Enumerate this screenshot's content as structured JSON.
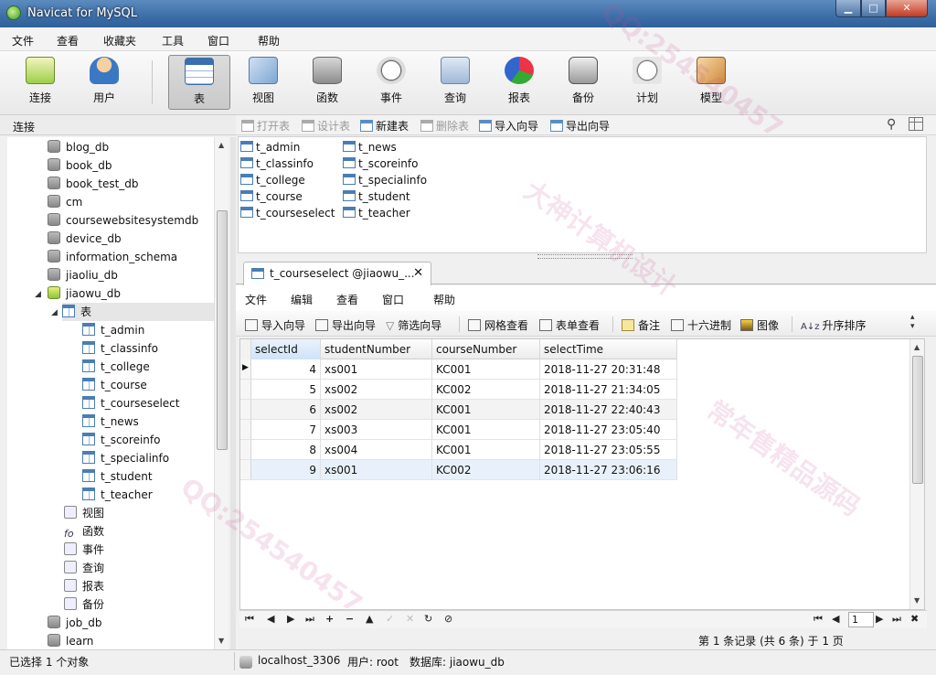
{
  "window": {
    "title": "Navicat for MySQL"
  },
  "menu": [
    "文件",
    "查看",
    "收藏夹",
    "工具",
    "窗口",
    "帮助"
  ],
  "toolbar": [
    {
      "label": "连接",
      "icon": "connection-icon"
    },
    {
      "label": "用户",
      "icon": "user-icon"
    },
    {
      "label": "表",
      "icon": "table-icon",
      "active": true
    },
    {
      "label": "视图",
      "icon": "view-icon"
    },
    {
      "label": "函数",
      "icon": "function-icon"
    },
    {
      "label": "事件",
      "icon": "event-icon"
    },
    {
      "label": "查询",
      "icon": "query-icon"
    },
    {
      "label": "报表",
      "icon": "report-icon"
    },
    {
      "label": "备份",
      "icon": "backup-icon"
    },
    {
      "label": "计划",
      "icon": "schedule-icon"
    },
    {
      "label": "模型",
      "icon": "model-icon"
    }
  ],
  "sidebar": {
    "header": "连接",
    "databases_top": [
      "blog_db",
      "book_db",
      "book_test_db",
      "cm",
      "coursewebsitesystemdb",
      "device_db",
      "information_schema",
      "jiaoliu_db"
    ],
    "open_db": "jiaowu_db",
    "tables_folder": "表",
    "tables": [
      "t_admin",
      "t_classinfo",
      "t_college",
      "t_course",
      "t_courseselect",
      "t_news",
      "t_scoreinfo",
      "t_specialinfo",
      "t_student",
      "t_teacher"
    ],
    "folders": [
      "视图",
      "函数",
      "事件",
      "查询",
      "报表",
      "备份"
    ],
    "databases_bottom": [
      "job_db",
      "learn"
    ]
  },
  "object_toolbar": {
    "open": "打开表",
    "design": "设计表",
    "new": "新建表",
    "delete": "删除表",
    "import": "导入向导",
    "export": "导出向导"
  },
  "objects": [
    "t_admin",
    "t_classinfo",
    "t_college",
    "t_course",
    "t_courseselect",
    "t_news",
    "t_scoreinfo",
    "t_specialinfo",
    "t_student",
    "t_teacher"
  ],
  "doc_tab": {
    "label": "t_courseselect @jiaowu_...",
    "close": "✕"
  },
  "doc_menu": [
    "文件",
    "编辑",
    "查看",
    "窗口",
    "帮助"
  ],
  "doc_toolbar": {
    "import": "导入向导",
    "export": "导出向导",
    "filter": "筛选向导",
    "grid": "网格查看",
    "form": "表单查看",
    "memo": "备注",
    "hex": "十六进制",
    "image": "图像",
    "sort": "升序排序"
  },
  "grid": {
    "columns": [
      "selectId",
      "studentNumber",
      "courseNumber",
      "selectTime"
    ],
    "rows": [
      [
        "4",
        "xs001",
        "KC001",
        "2018-11-27 20:31:48"
      ],
      [
        "5",
        "xs002",
        "KC002",
        "2018-11-27 21:34:05"
      ],
      [
        "6",
        "xs002",
        "KC001",
        "2018-11-27 22:40:43"
      ],
      [
        "7",
        "xs003",
        "KC001",
        "2018-11-27 23:05:40"
      ],
      [
        "8",
        "xs004",
        "KC001",
        "2018-11-27 23:05:55"
      ],
      [
        "9",
        "xs001",
        "KC002",
        "2018-11-27 23:06:16"
      ]
    ]
  },
  "nav": {
    "page": "1"
  },
  "record_info": "第 1 条记录 (共 6 条) 于 1 页",
  "status": {
    "selection": "已选择 1 个对象",
    "connection": "localhost_3306",
    "user": "用户: root",
    "database": "数据库: jiaowu_db"
  },
  "watermarks": [
    "大神计算机设计",
    "QQ:254540457",
    "常年售精品源码"
  ],
  "colors": {
    "titlebar": "#3d6ea8",
    "selection": "#e8f1fb",
    "header_selected": "#cfe3f8",
    "close_button": "#c43a20"
  }
}
